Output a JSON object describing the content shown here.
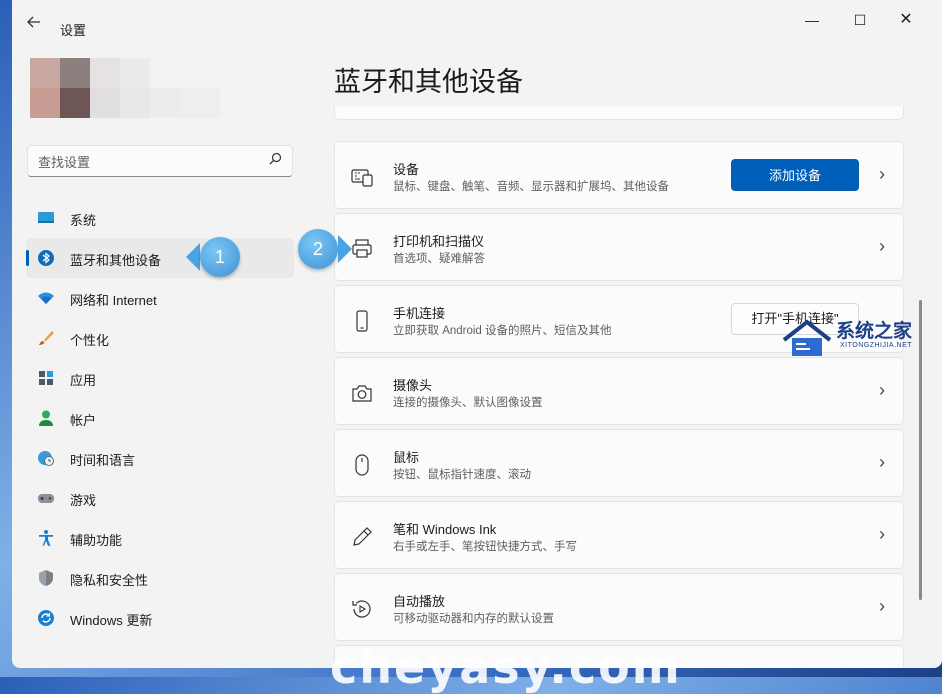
{
  "window": {
    "title": "设置",
    "back_icon": "arrow-left-icon",
    "controls": {
      "minimize": "—",
      "maximize": "☐",
      "close": "✕"
    }
  },
  "search": {
    "placeholder": "查找设置",
    "icon": "search-icon"
  },
  "nav": {
    "items": [
      {
        "label": "系统",
        "icon": "display-icon",
        "active": false
      },
      {
        "label": "蓝牙和其他设备",
        "icon": "bluetooth-icon",
        "active": true
      },
      {
        "label": "网络和 Internet",
        "icon": "wifi-icon",
        "active": false
      },
      {
        "label": "个性化",
        "icon": "brush-icon",
        "active": false
      },
      {
        "label": "应用",
        "icon": "apps-icon",
        "active": false
      },
      {
        "label": "帐户",
        "icon": "person-icon",
        "active": false
      },
      {
        "label": "时间和语言",
        "icon": "globe-clock-icon",
        "active": false
      },
      {
        "label": "游戏",
        "icon": "gamepad-icon",
        "active": false
      },
      {
        "label": "辅助功能",
        "icon": "accessibility-icon",
        "active": false
      },
      {
        "label": "隐私和安全性",
        "icon": "shield-icon",
        "active": false
      },
      {
        "label": "Windows 更新",
        "icon": "update-icon",
        "active": false
      }
    ]
  },
  "callouts": [
    {
      "label": "1"
    },
    {
      "label": "2"
    }
  ],
  "main": {
    "title": "蓝牙和其他设备",
    "cards": [
      {
        "title": "设备",
        "subtitle": "鼠标、键盘、触笔、音频、显示器和扩展坞、其他设备",
        "icon": "keyboard-device-icon",
        "button": "添加设备"
      },
      {
        "title": "打印机和扫描仪",
        "subtitle": "首选项、疑难解答",
        "icon": "printer-icon"
      },
      {
        "title": "手机连接",
        "subtitle": "立即获取 Android 设备的照片、短信及其他",
        "icon": "phone-icon",
        "button": "打开\"手机连接\""
      },
      {
        "title": "摄像头",
        "subtitle": "连接的摄像头、默认图像设置",
        "icon": "camera-icon"
      },
      {
        "title": "鼠标",
        "subtitle": "按钮、鼠标指针速度、滚动",
        "icon": "mouse-icon"
      },
      {
        "title": "笔和 Windows Ink",
        "subtitle": "右手或左手、笔按钮快捷方式、手写",
        "icon": "pen-icon"
      },
      {
        "title": "自动播放",
        "subtitle": "可移动驱动器和内存的默认设置",
        "icon": "autoplay-icon"
      }
    ]
  },
  "watermark": {
    "text": "系统之家",
    "sub": "XITONGZHIJIA.NET",
    "bottom": "cheyasy.com"
  },
  "colors": {
    "accent": "#005fb8",
    "callout": "#4aa3e6"
  }
}
